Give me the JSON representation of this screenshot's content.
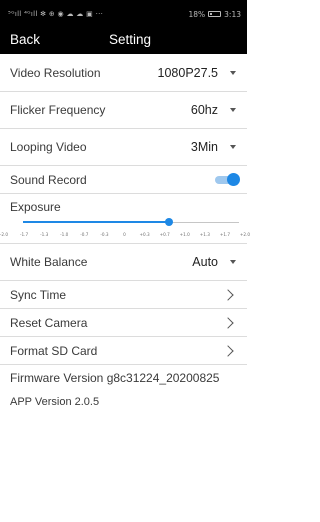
{
  "status_bar": {
    "left_text": "⁵ᴳıll ⁴ᴳıll ✻ ⊕ ◉ ☁ ☁ ▣ ···",
    "battery_pct": "18%",
    "time": "3:13"
  },
  "nav": {
    "back_label": "Back",
    "title": "Setting"
  },
  "settings": {
    "video_resolution": {
      "label": "Video Resolution",
      "value": "1080P27.5"
    },
    "flicker_frequency": {
      "label": "Flicker Frequency",
      "value": "60hz"
    },
    "looping_video": {
      "label": "Looping Video",
      "value": "3Min"
    },
    "sound_record": {
      "label": "Sound Record",
      "enabled": true
    },
    "exposure": {
      "label": "Exposure",
      "ticks": [
        "-2.0",
        "-1.7",
        "-1.3",
        "-1.0",
        "-0.7",
        "-0.3",
        "0",
        "+0.3",
        "+0.7",
        "+1.0",
        "+1.3",
        "+1.7",
        "+2.0"
      ],
      "value": 0.7
    },
    "white_balance": {
      "label": "White Balance",
      "value": "Auto"
    },
    "sync_time": {
      "label": "Sync Time"
    },
    "reset_camera": {
      "label": "Reset Camera"
    },
    "format_sd": {
      "label": "Format SD Card"
    }
  },
  "firmware_text": "Firmware Version g8c31224_20200825",
  "app_version_text": "APP Version 2.0.5",
  "colors": {
    "accent": "#1e88e5",
    "header_bg": "#000000",
    "divider": "#dcdcdc"
  }
}
